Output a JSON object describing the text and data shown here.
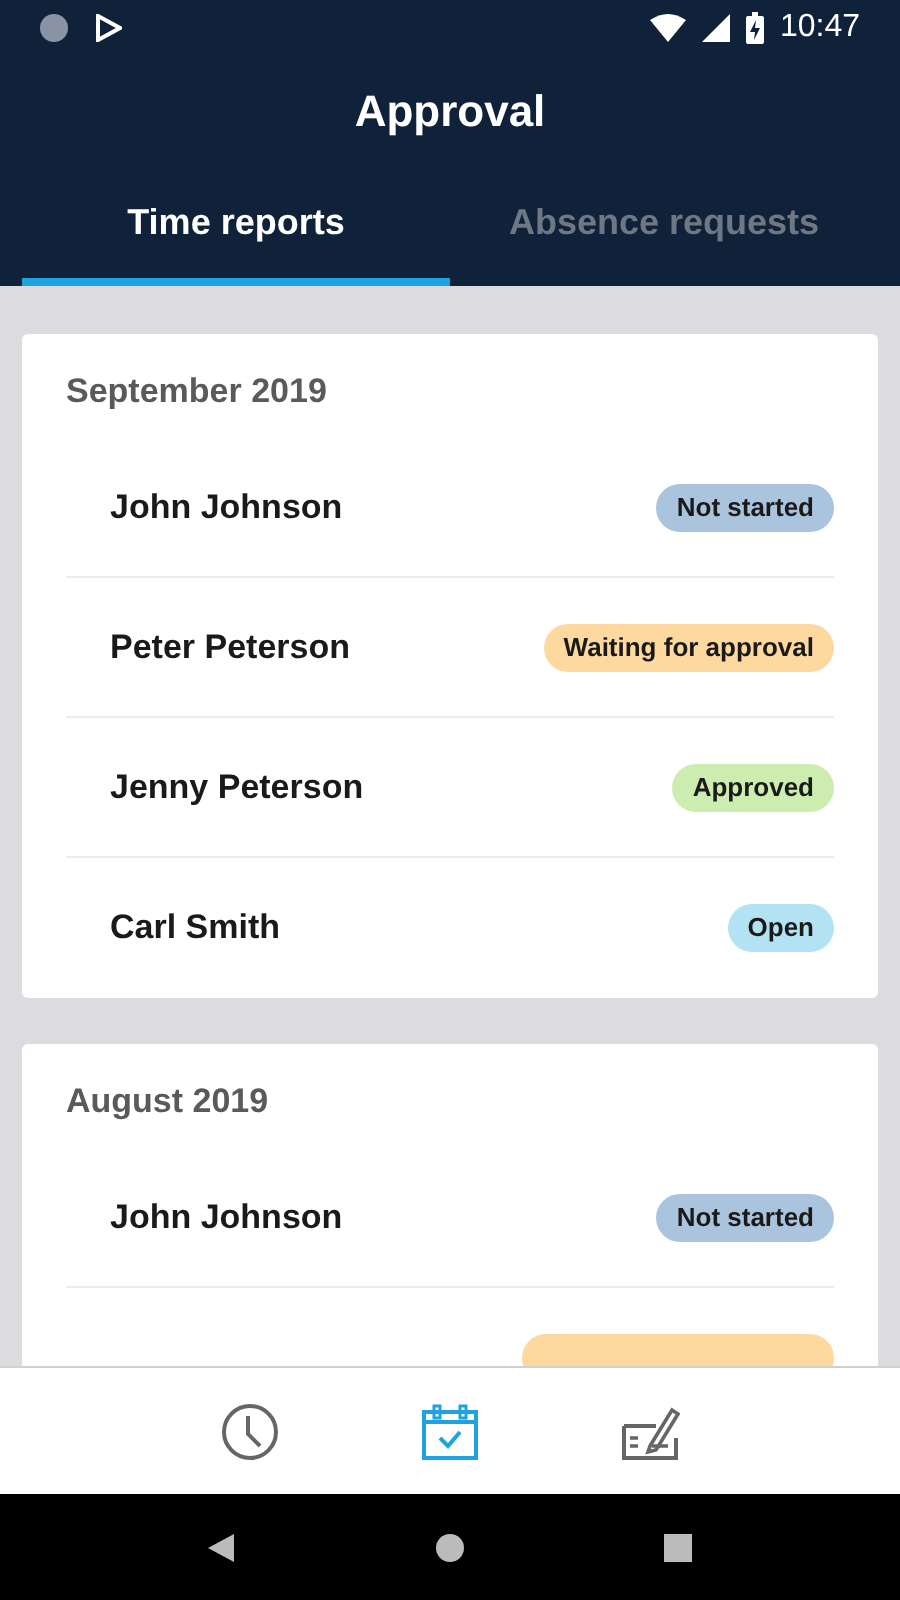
{
  "status_bar": {
    "time": "10:47"
  },
  "header": {
    "title": "Approval"
  },
  "tabs": [
    {
      "label": "Time reports",
      "selected": true
    },
    {
      "label": "Absence requests",
      "selected": false
    }
  ],
  "sections": [
    {
      "month": "September 2019",
      "items": [
        {
          "name": "John Johnson",
          "status": "Not started",
          "color": "#a9c4dc"
        },
        {
          "name": "Peter Peterson",
          "status": "Waiting for approval",
          "color": "#fdd9a0"
        },
        {
          "name": "Jenny Peterson",
          "status": "Approved",
          "color": "#cdecb0"
        },
        {
          "name": "Carl Smith",
          "status": "Open",
          "color": "#b3e3f3"
        }
      ]
    },
    {
      "month": "August 2019",
      "items": [
        {
          "name": "John Johnson",
          "status": "Not started",
          "color": "#a9c4dc"
        },
        {
          "color": "#fdd9a0"
        }
      ]
    }
  ],
  "bottom_nav": [
    {
      "kind": "clock",
      "selected": false
    },
    {
      "kind": "calendar",
      "selected": true
    },
    {
      "kind": "check",
      "selected": false
    }
  ]
}
